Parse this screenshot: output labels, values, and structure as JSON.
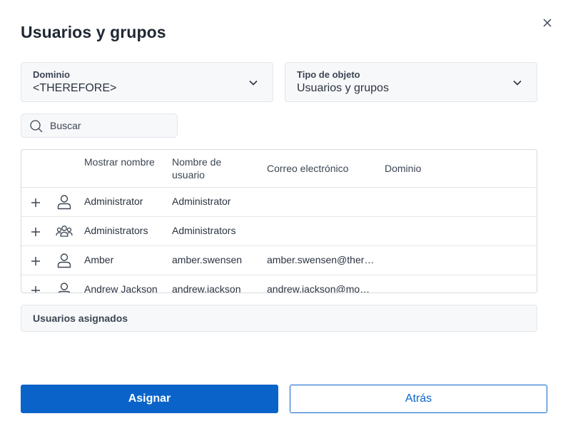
{
  "dialog": {
    "title": "Usuarios y grupos"
  },
  "filters": {
    "domain": {
      "label": "Dominio",
      "value": "<THEREFORE>"
    },
    "object_type": {
      "label": "Tipo de objeto",
      "value": "Usuarios y grupos"
    }
  },
  "search": {
    "placeholder": "Buscar",
    "value": ""
  },
  "table": {
    "columns": [
      "Mostrar nombre",
      "Nombre de usuario",
      "Correo electrónico",
      "Dominio"
    ],
    "rows": [
      {
        "display_name": "Administrator",
        "username": "Administrator",
        "email": "",
        "domain": "",
        "icon": "user-icon"
      },
      {
        "display_name": "Administrators",
        "username": "Administrators",
        "email": "",
        "domain": "",
        "icon": "group-icon"
      },
      {
        "display_name": "Amber",
        "username": "amber.swensen",
        "email": "amber.swensen@ther…",
        "domain": "",
        "icon": "user-icon"
      },
      {
        "display_name": "Andrew Jackson",
        "username": "andrew.jackson",
        "email": "andrew.jackson@mo…",
        "domain": "",
        "icon": "user-icon"
      }
    ]
  },
  "assigned": {
    "label": "Usuarios asignados"
  },
  "buttons": {
    "assign": "Asignar",
    "back": "Atrás"
  },
  "colors": {
    "accent": "#0a63c9",
    "text": "#2b3340",
    "border": "#e3e6ea"
  }
}
